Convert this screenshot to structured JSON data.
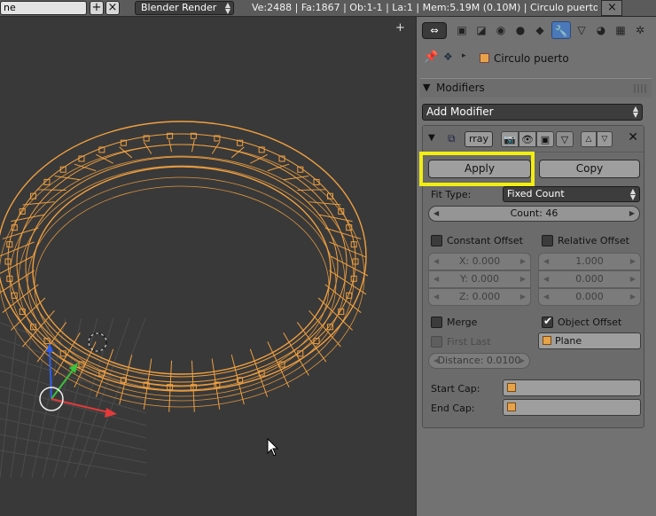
{
  "topbar": {
    "scene_fragment": "ne",
    "add_glyph": "+",
    "close_glyph": "×",
    "render_engine": "Blender Render",
    "stats": "Ve:2488 | Fa:1867 | Ob:1-1 | La:1 | Mem:5.19M (0.10M) | Circulo puerto",
    "close_right": "×"
  },
  "viewport": {
    "header_plus": "+"
  },
  "properties": {
    "context_toggle": "⇔",
    "breadcrumb": {
      "object_name": "Circulo puerto"
    },
    "modifiers_panel": {
      "title": "Modifiers",
      "add_modifier_label": "Add Modifier",
      "modifier": {
        "name": "rray",
        "apply_label": "Apply",
        "copy_label": "Copy",
        "fit_type_label": "Fit Type:",
        "fit_type_value": "Fixed Count",
        "count_label": "Count: 46",
        "constant_offset": {
          "label": "Constant Offset",
          "checked": false,
          "x": "X: 0.000",
          "y": "Y: 0.000",
          "z": "Z: 0.000"
        },
        "relative_offset": {
          "label": "Relative Offset",
          "checked": false,
          "x": "1.000",
          "y": "0.000",
          "z": "0.000"
        },
        "merge": {
          "label": "Merge",
          "checked": false
        },
        "first_last": {
          "label": "First Last",
          "checked": false
        },
        "distance": "Distance: 0.0100",
        "object_offset": {
          "label": "Object Offset",
          "checked": true,
          "object": "Plane"
        },
        "start_cap_label": "Start Cap:",
        "end_cap_label": "End Cap:"
      }
    }
  },
  "colors": {
    "wire": "#f0a040",
    "highlight": "#f2ee10",
    "active_tab": "#4a78b8"
  }
}
